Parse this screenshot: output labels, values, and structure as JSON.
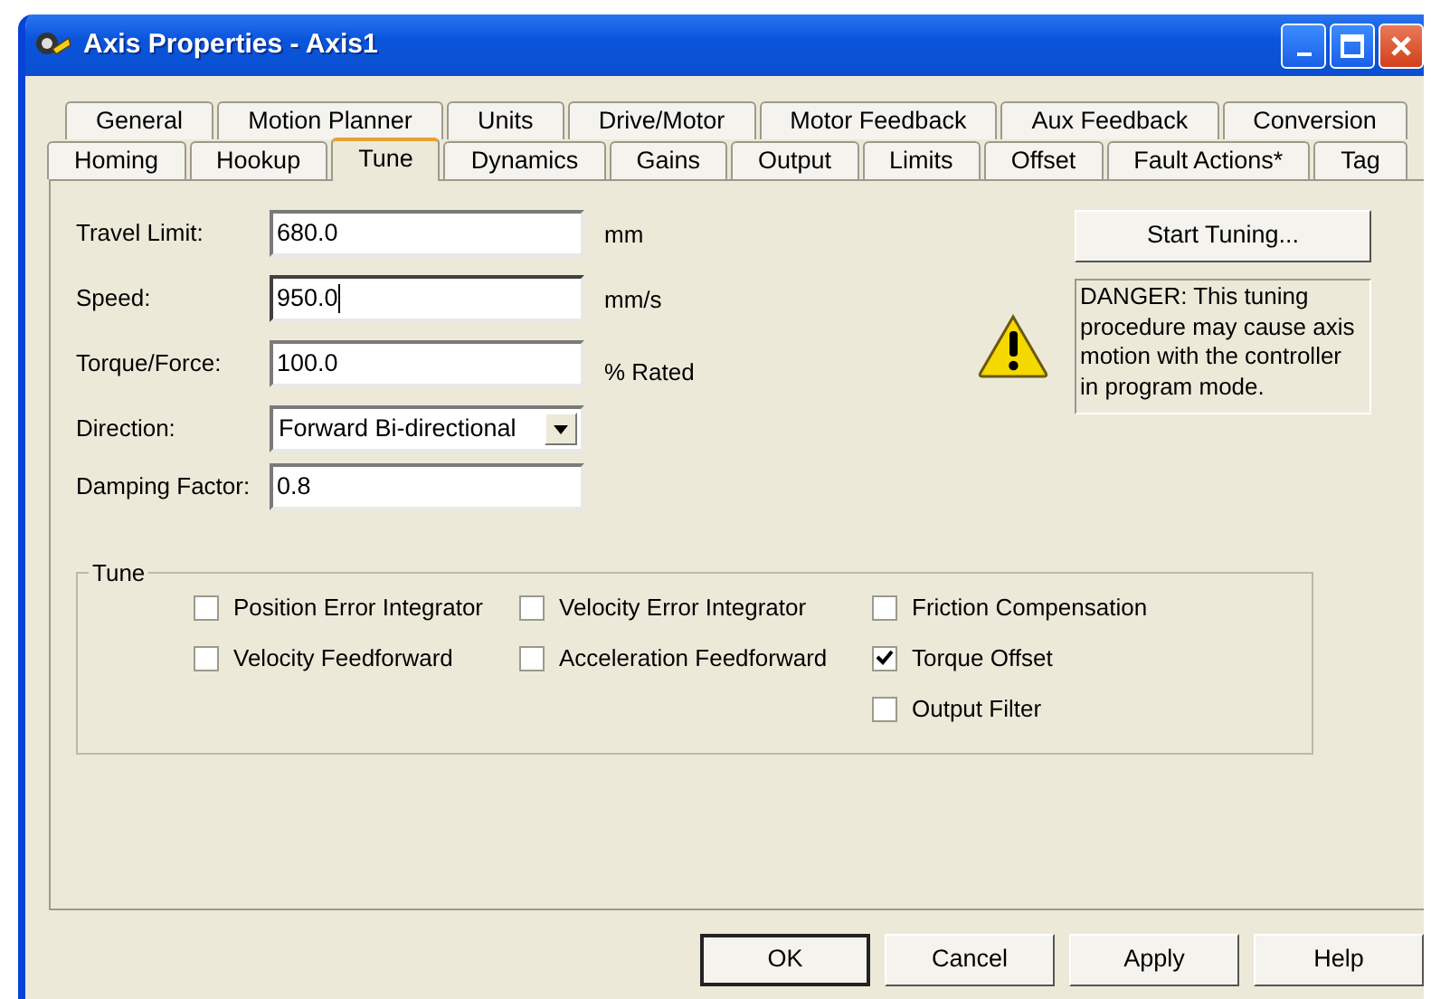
{
  "window": {
    "title": "Axis Properties - Axis1"
  },
  "tab_rows": [
    [
      {
        "label": "General",
        "selected": false
      },
      {
        "label": "Motion Planner",
        "selected": false
      },
      {
        "label": "Units",
        "selected": false
      },
      {
        "label": "Drive/Motor",
        "selected": false
      },
      {
        "label": "Motor Feedback",
        "selected": false
      },
      {
        "label": "Aux Feedback",
        "selected": false
      },
      {
        "label": "Conversion",
        "selected": false
      }
    ],
    [
      {
        "label": "Homing",
        "selected": false
      },
      {
        "label": "Hookup",
        "selected": false
      },
      {
        "label": "Tune",
        "selected": true
      },
      {
        "label": "Dynamics",
        "selected": false
      },
      {
        "label": "Gains",
        "selected": false
      },
      {
        "label": "Output",
        "selected": false
      },
      {
        "label": "Limits",
        "selected": false
      },
      {
        "label": "Offset",
        "selected": false
      },
      {
        "label": "Fault Actions*",
        "selected": false
      },
      {
        "label": "Tag",
        "selected": false
      }
    ]
  ],
  "fields": [
    {
      "kind": "text",
      "label": "Travel Limit:",
      "value": "680.0",
      "unit": "mm",
      "focused": false
    },
    {
      "kind": "text",
      "label": "Speed:",
      "value": "950.0",
      "unit": "mm/s",
      "focused": true
    },
    {
      "kind": "text",
      "label": "Torque/Force:",
      "value": "100.0",
      "unit": "% Rated",
      "focused": false
    },
    {
      "kind": "select",
      "label": "Direction:",
      "value": "Forward Bi-directional",
      "focused": false
    },
    {
      "kind": "text",
      "label": "Damping Factor:",
      "value": "0.8",
      "focused": false
    }
  ],
  "start_button": "Start Tuning...",
  "danger_text": "DANGER: This tuning procedure may cause axis motion with the controller in program mode.",
  "tune_group": {
    "title": "Tune",
    "columns": [
      [
        {
          "label": "Position Error Integrator",
          "checked": false
        },
        {
          "label": "Velocity Feedforward",
          "checked": false
        }
      ],
      [
        {
          "label": "Velocity Error Integrator",
          "checked": false
        },
        {
          "label": "Acceleration Feedforward",
          "checked": false
        }
      ],
      [
        {
          "label": "Friction Compensation",
          "checked": false
        },
        {
          "label": "Torque Offset",
          "checked": true
        },
        {
          "label": "Output Filter",
          "checked": false
        }
      ]
    ]
  },
  "buttons": [
    {
      "label": "OK",
      "default": true
    },
    {
      "label": "Cancel",
      "default": false
    },
    {
      "label": "Apply",
      "default": false
    },
    {
      "label": "Help",
      "default": false
    }
  ]
}
